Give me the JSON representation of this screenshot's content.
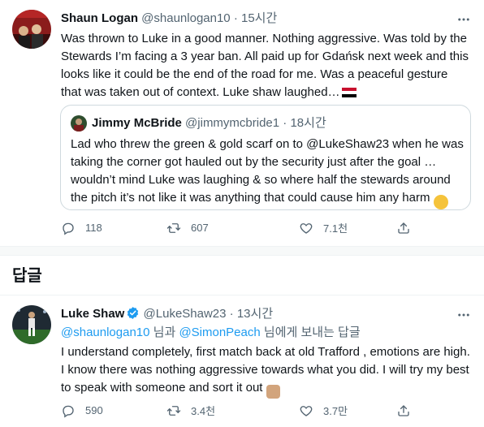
{
  "tweet1": {
    "name": "Shaun Logan",
    "handle": "@shaunlogan10",
    "separator": "·",
    "time": "15시간",
    "lines": [
      "Was thrown to Luke in a good manner. Nothing aggressive. Was told by the",
      "Stewards I’m facing a 3 year ban. All paid up for Gdańsk next week and this",
      "looks like it could be the end of the road for me. Was a peaceful gesture",
      "that was taken out of context. Luke shaw laughed…"
    ],
    "flag": "🇪🇬",
    "quote": {
      "name": "Jimmy McBride",
      "handle": "@jimmymcbride1",
      "separator": "·",
      "time": "18시간",
      "lines": [
        "Lad who threw the green & gold scarf on to @LukeShaw23 when he was",
        "taking the corner got hauled out by the security just after the goal …",
        "wouldn’t mind Luke was laughing & so where half the stewards around",
        "the pitch it’s not like it was anything that could cause him any harm"
      ],
      "emoji": "😟"
    },
    "stats": {
      "replies": "118",
      "retweets": "607",
      "likes": "7.1천"
    }
  },
  "section": {
    "title": "답글"
  },
  "tweet2": {
    "name": "Luke Shaw",
    "handle": "@LukeShaw23",
    "separator": "·",
    "time": "13시간",
    "reply_to_1": "@shaunlogan10",
    "reply_joiner": "님과",
    "reply_to_2": "@SimonPeach",
    "reply_suffix": "님에게 보내는 답글",
    "lines": [
      "I understand completely, first match back at old Trafford , emotions are high.",
      "I know there was nothing aggressive towards what you did. I will try my best",
      "to speak with someone and sort it out"
    ],
    "emoji": "👍🏼",
    "stats": {
      "replies": "590",
      "retweets": "3.4천",
      "likes": "3.7만"
    }
  },
  "colors": {
    "accent": "#1d9bf0",
    "muted": "#536471",
    "text": "#0f1419",
    "border": "#cfd9de"
  },
  "icons": [
    "more-icon",
    "reply-icon",
    "retweet-icon",
    "like-icon",
    "verified-icon"
  ]
}
